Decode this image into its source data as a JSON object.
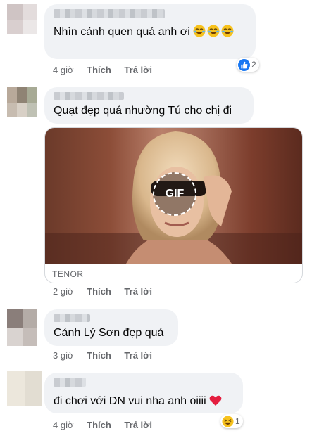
{
  "comments": [
    {
      "text": "Nhìn cảnh quen quá anh ơi",
      "emoji": "laughing-emoji-x3",
      "time": "4 giờ",
      "like_label": "Thích",
      "reply_label": "Trả lời",
      "reaction": {
        "type": "like",
        "count": "2"
      }
    },
    {
      "text": "Quạt đẹp quá nhường Tú cho chị đi",
      "gif": {
        "badge": "GIF",
        "provider": "TENOR"
      },
      "time": "2 giờ",
      "like_label": "Thích",
      "reply_label": "Trả lời"
    },
    {
      "text": "Cảnh Lý Sơn đẹp quá",
      "time": "3 giờ",
      "like_label": "Thích",
      "reply_label": "Trả lời"
    },
    {
      "text": "đi chơi với DN vui nha anh oiiii",
      "emoji": "red-heart-emoji",
      "time": "4 giờ",
      "like_label": "Thích",
      "reply_label": "Trả lời",
      "reaction": {
        "type": "haha",
        "count": "1"
      }
    }
  ],
  "colors": {
    "bubble": "#f0f2f5",
    "meta_text": "#65676b",
    "like_blue": "#1877f2",
    "heart_red": "#e41e3f"
  }
}
